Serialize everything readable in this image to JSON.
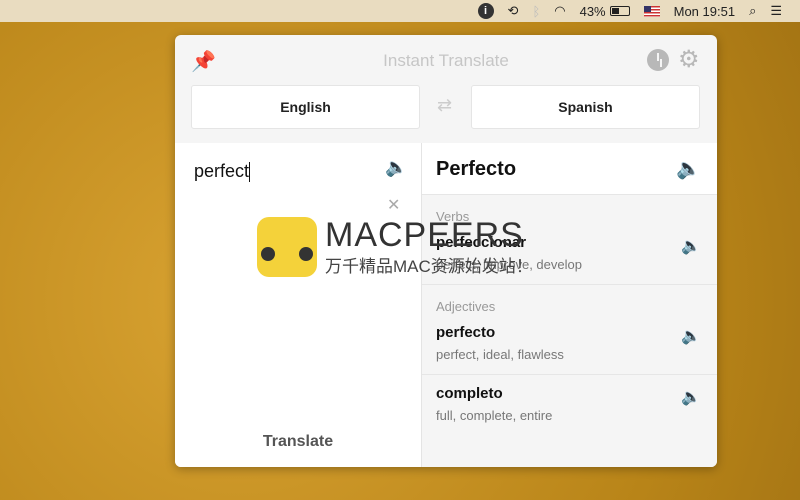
{
  "menubar": {
    "battery": "43%",
    "clock": "Mon 19:51",
    "battery_level": 0.43
  },
  "panel": {
    "title": "Instant Translate",
    "source_lang": "English",
    "target_lang": "Spanish",
    "input": "perfect",
    "translate_label": "Translate",
    "main_translation": "Perfecto",
    "sections": [
      {
        "label": "Verbs",
        "entries": [
          {
            "word": "perfeccionar",
            "synonyms": "perfect, improve, develop"
          }
        ]
      },
      {
        "label": "Adjectives",
        "entries": [
          {
            "word": "perfecto",
            "synonyms": "perfect, ideal, flawless"
          },
          {
            "word": "completo",
            "synonyms": "full, complete, entire"
          }
        ]
      }
    ]
  },
  "watermark": {
    "title": "MACPEERS",
    "subtitle": "万千精品MAC资源始发站！"
  }
}
